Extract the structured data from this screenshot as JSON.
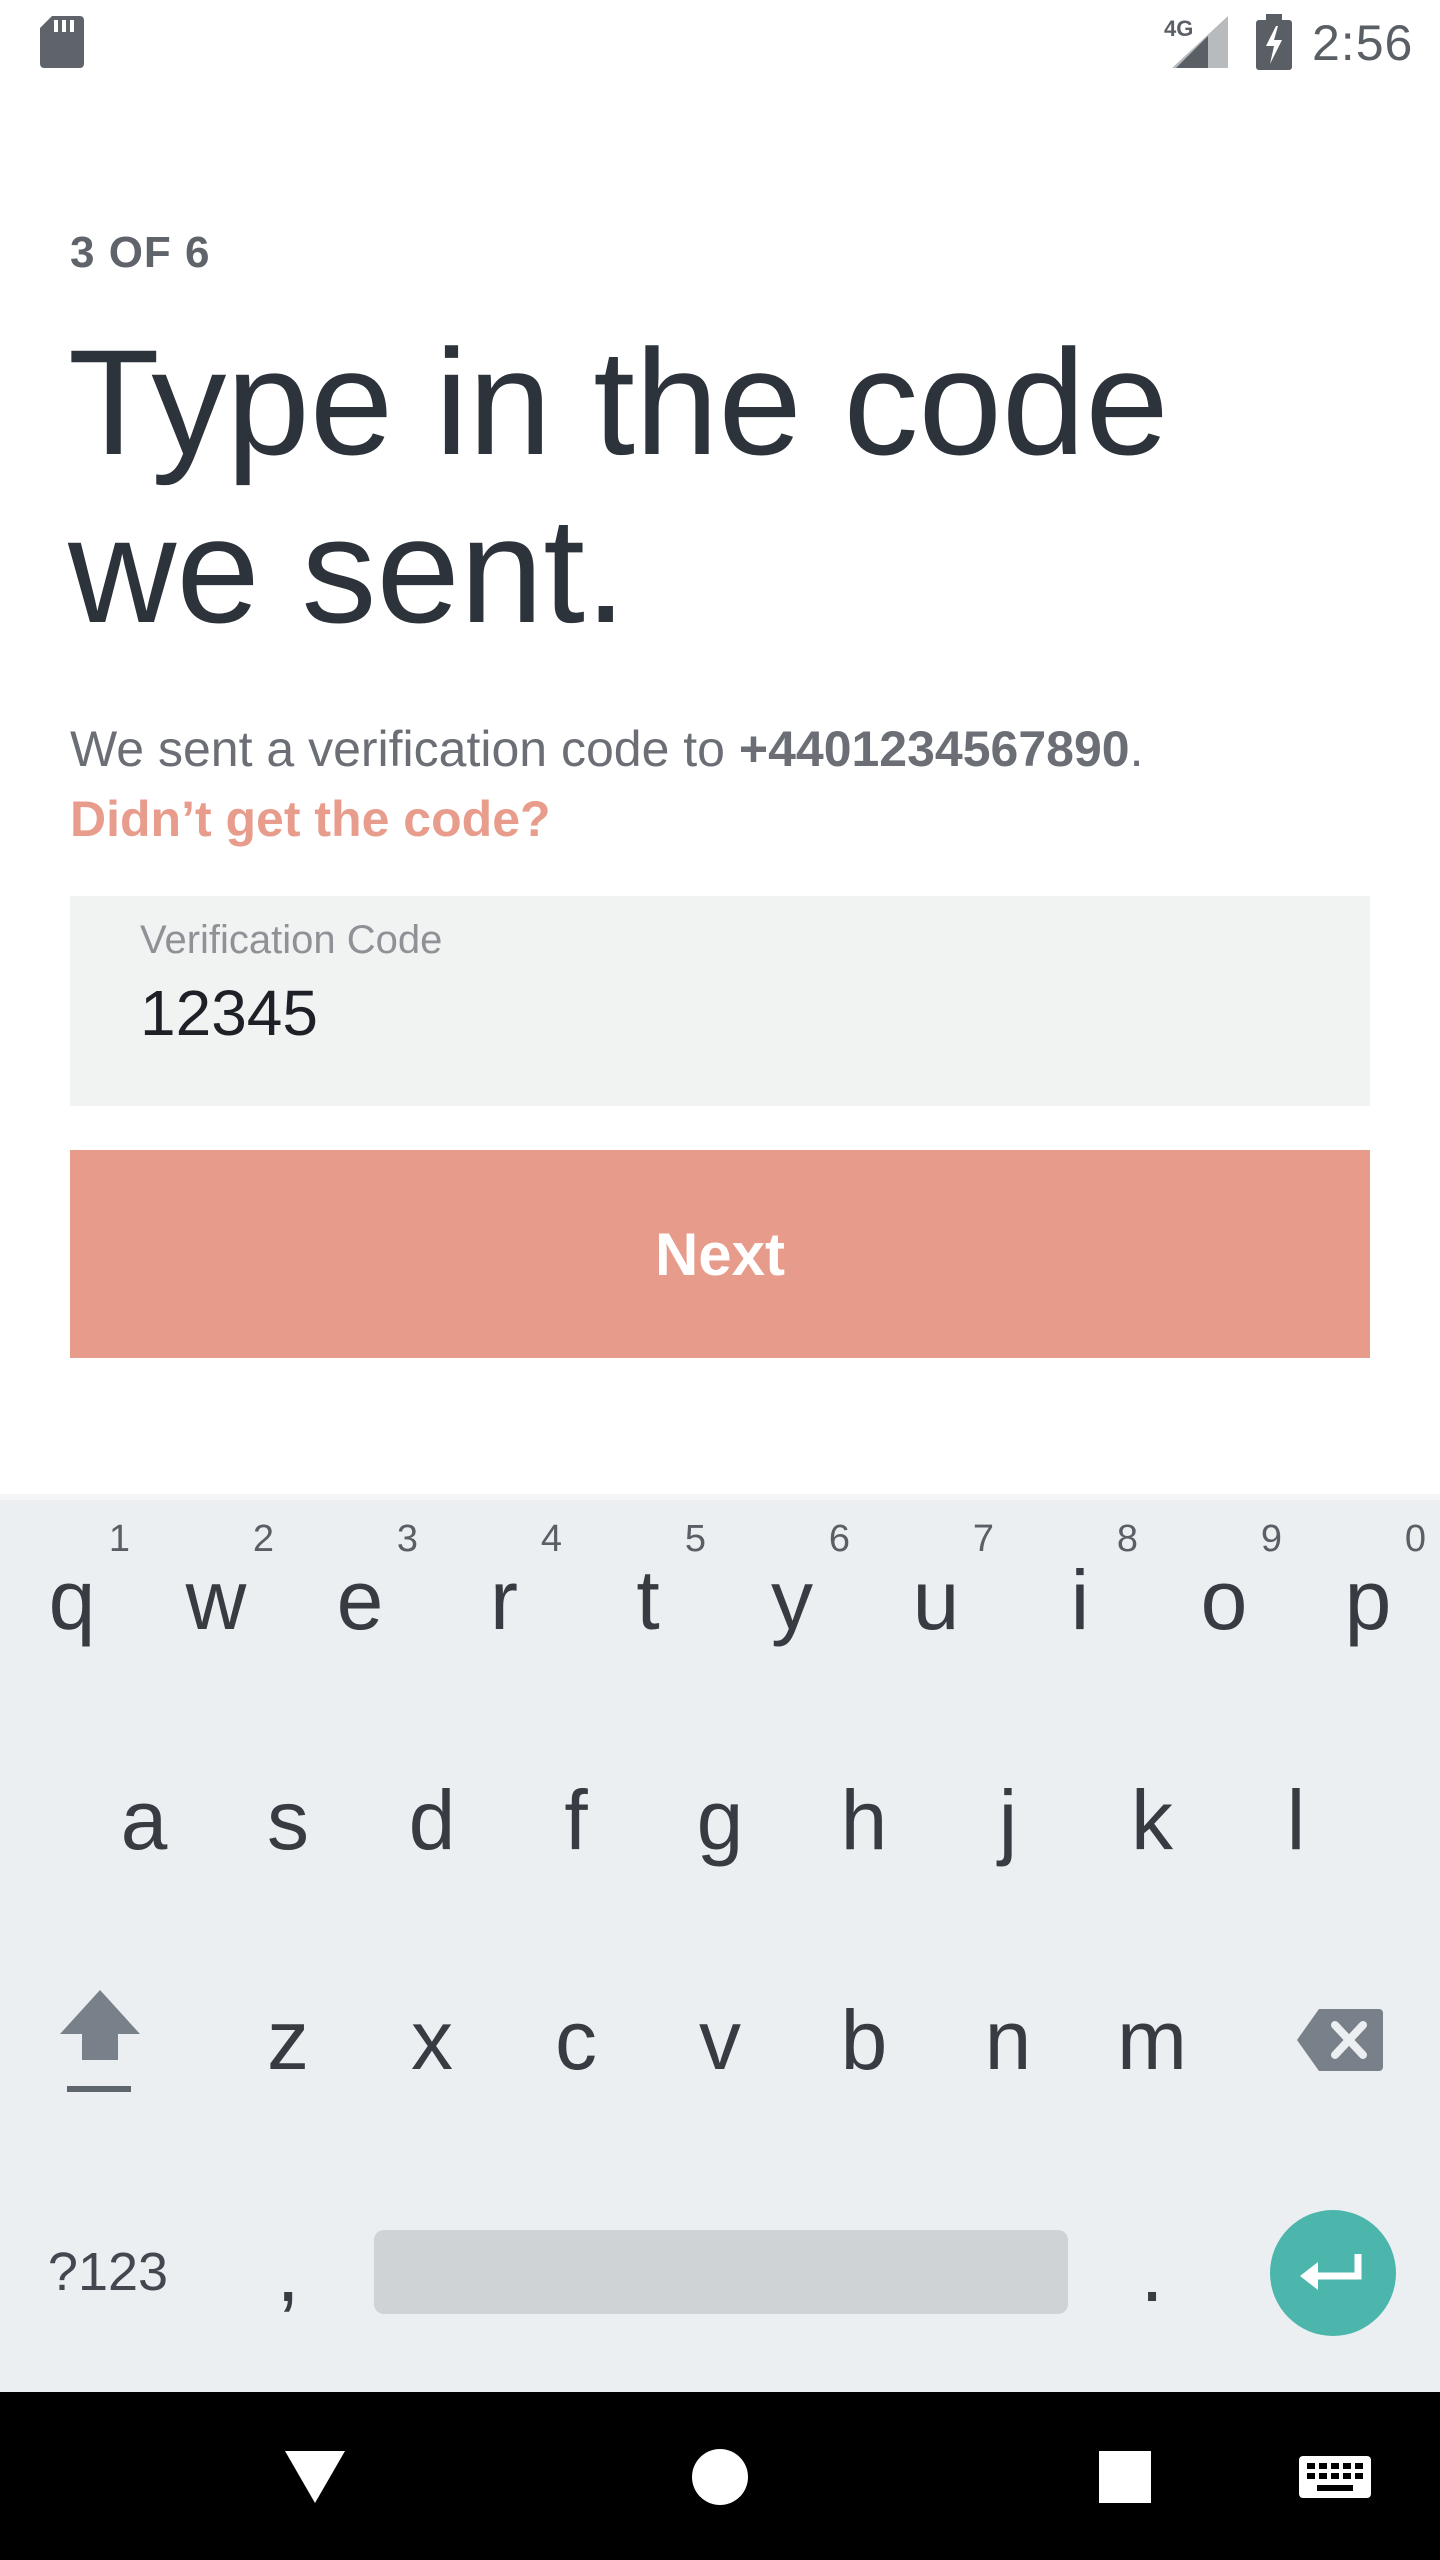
{
  "status_bar": {
    "network_label": "4G",
    "time": "2:56",
    "icons": [
      "sd-card-icon",
      "signal-icon",
      "battery-charging-icon"
    ]
  },
  "content": {
    "step": "3 OF 6",
    "headline_line1": "Type in the code",
    "headline_line2": "we sent.",
    "info_prefix": "We sent a verification code to ",
    "phone": "+4401234567890",
    "info_suffix": ".",
    "resend_link": "Didn’t get the code?",
    "field_label": "Verification Code",
    "field_value": "12345",
    "next_label": "Next"
  },
  "keyboard": {
    "row1": [
      "q",
      "w",
      "e",
      "r",
      "t",
      "y",
      "u",
      "i",
      "o",
      "p"
    ],
    "row1_hints": [
      "1",
      "2",
      "3",
      "4",
      "5",
      "6",
      "7",
      "8",
      "9",
      "0"
    ],
    "row2": [
      "a",
      "s",
      "d",
      "f",
      "g",
      "h",
      "j",
      "k",
      "l"
    ],
    "row3": [
      "z",
      "x",
      "c",
      "v",
      "b",
      "n",
      "m"
    ],
    "symbols_key": "?123",
    "comma": ",",
    "period": "."
  },
  "nav_bar": {
    "buttons": [
      "back-icon",
      "home-icon",
      "recents-icon",
      "keyboard-icon"
    ]
  },
  "colors": {
    "accent": "#e79b8b",
    "text_dark": "#2d333b",
    "field_bg": "#f1f2f2",
    "keyboard_bg": "#eceff1",
    "enter_key": "#4db6ac"
  }
}
